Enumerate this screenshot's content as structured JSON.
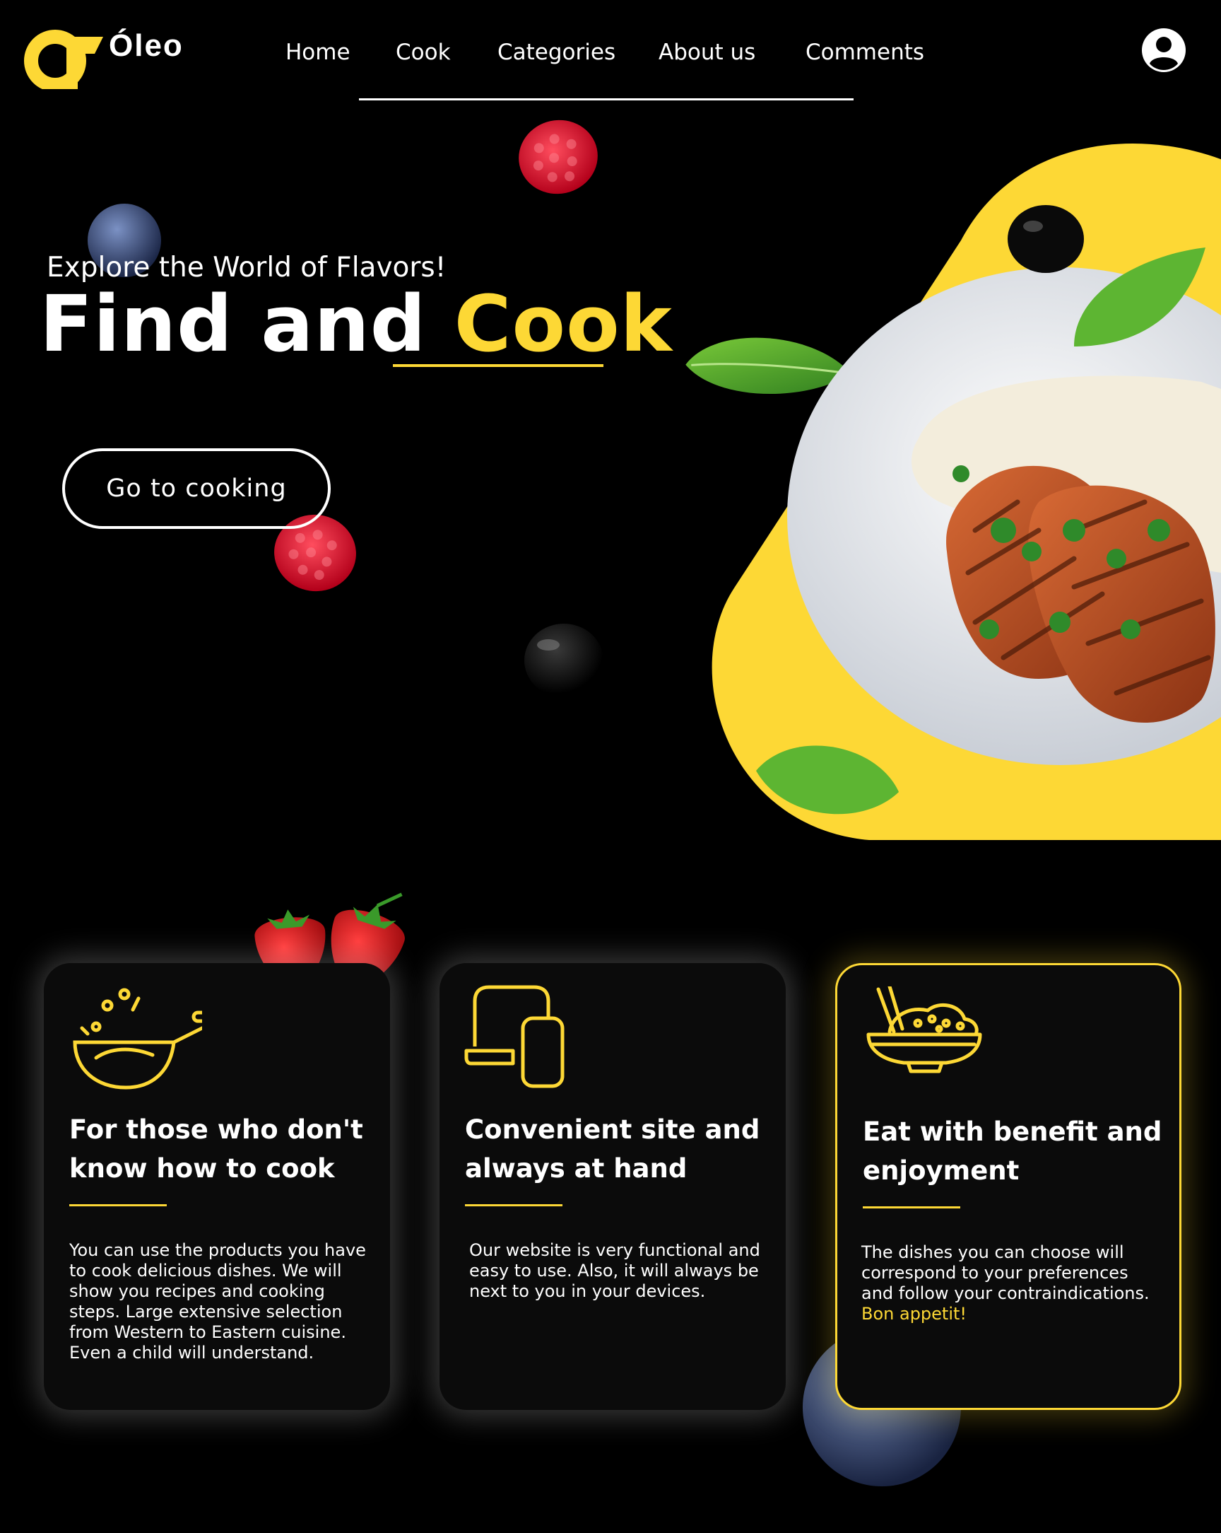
{
  "brand": {
    "name": "Óleo",
    "logo_icon": "oleo-logo-icon"
  },
  "nav": {
    "items": [
      "Home",
      "Cook",
      "Categories",
      "About us",
      "Comments"
    ]
  },
  "user": {
    "icon": "user-avatar-icon"
  },
  "hero": {
    "kicker": "Explore the World of Flavors!",
    "headline_plain": "Find and ",
    "headline_accent": "Cook",
    "cta_label": "Go to cooking",
    "image": "grilled-chicken-plate"
  },
  "cards": [
    {
      "icon": "wok-pan-icon",
      "title": "For those who don't know how to cook",
      "body": "You can use the products you have to cook delicious dishes. We will show you recipes and cooking steps. Large extensive selection from Western to Eastern cuisine. Even a child will understand.",
      "body_accent": ""
    },
    {
      "icon": "laptop-phone-icon",
      "title": "Convenient site and always at hand",
      "body": "Our website is very functional and easy to use. Also, it will always be next to you in your devices.",
      "body_accent": ""
    },
    {
      "icon": "rice-bowl-chopsticks-icon",
      "title": "Eat with benefit and enjoyment",
      "body": "The dishes you can choose will correspond to your preferences and follow your contraindications.",
      "body_accent": "Bon appetit!"
    }
  ],
  "colors": {
    "background": "#000000",
    "accent": "#fdd835",
    "card": "#0b0b0b",
    "text": "#ffffff"
  }
}
